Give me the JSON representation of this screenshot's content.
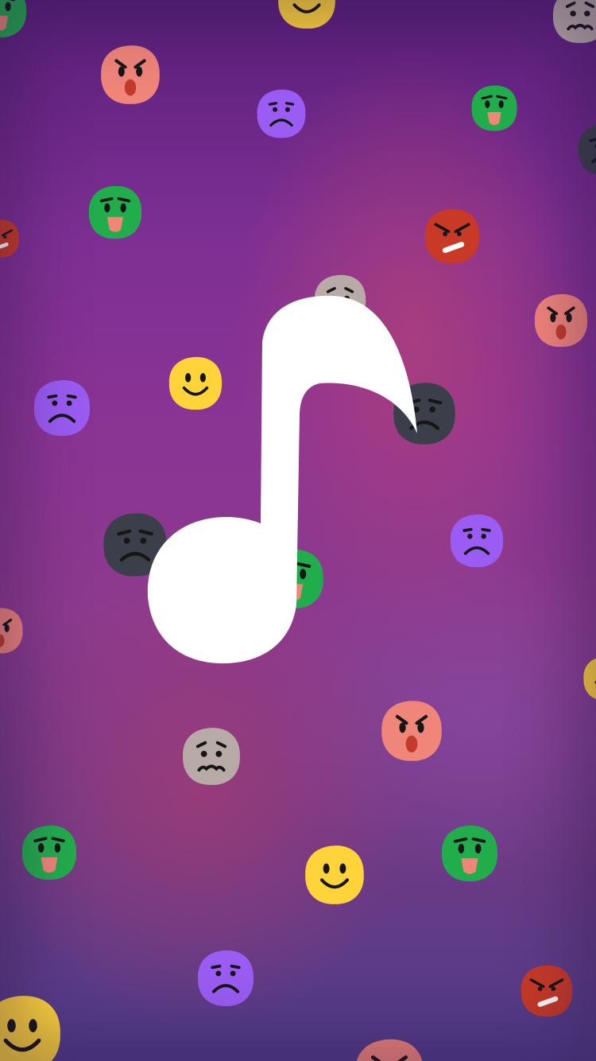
{
  "screen": {
    "background_colors": [
      "#5a1f7a",
      "#8a3494",
      "#c8466e",
      "#4f3c88"
    ]
  },
  "app_icon": {
    "icon": "music-note-icon",
    "color": "#ffffff"
  },
  "emoji_palette": {
    "angry": "#f0857a",
    "sad": "#9a5cf2",
    "sick": "#22ad4c",
    "mad": "#c83a26",
    "happy": "#ffd43a",
    "gloomy": "#3b3f4a",
    "worried": "#b8aaa6"
  },
  "emojis": [
    {
      "name": "happy-face-icon"
    },
    {
      "name": "angry-face-icon"
    },
    {
      "name": "sad-face-icon"
    },
    {
      "name": "sick-face-icon"
    },
    {
      "name": "mad-face-icon"
    },
    {
      "name": "gloomy-face-icon"
    },
    {
      "name": "worried-face-icon"
    }
  ]
}
